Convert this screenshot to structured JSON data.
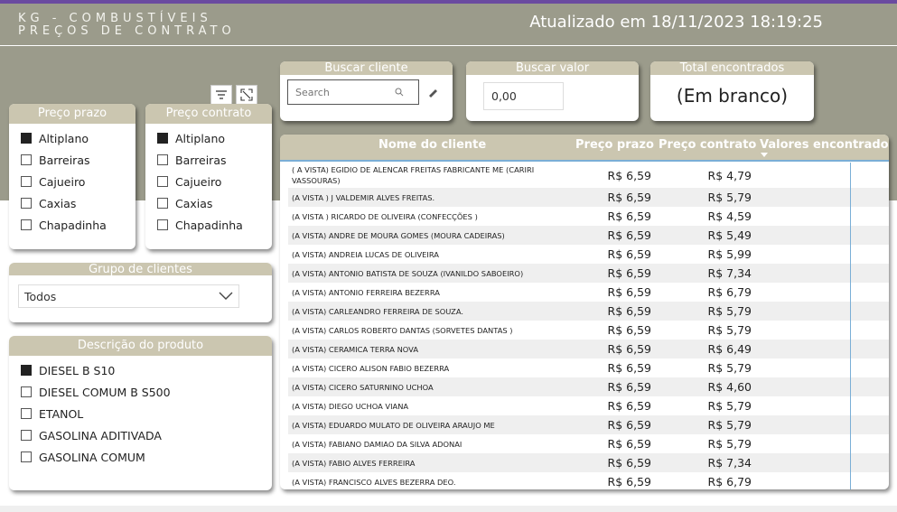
{
  "header": {
    "title_line1": "KG - COMBUSTÍVEIS",
    "title_line2": "PREÇOS DE CONTRATO",
    "updated": "Atualizado em 18/11/2023 18:19:25"
  },
  "preco_prazo": {
    "title": "Preço prazo",
    "items": [
      {
        "label": "Altiplano",
        "checked": true
      },
      {
        "label": "Barreiras",
        "checked": false
      },
      {
        "label": "Cajueiro",
        "checked": false
      },
      {
        "label": "Caxias",
        "checked": false
      },
      {
        "label": "Chapadinha",
        "checked": false
      }
    ]
  },
  "preco_contrato": {
    "title": "Preço contrato",
    "items": [
      {
        "label": "Altiplano",
        "checked": true
      },
      {
        "label": "Barreiras",
        "checked": false
      },
      {
        "label": "Cajueiro",
        "checked": false
      },
      {
        "label": "Caxias",
        "checked": false
      },
      {
        "label": "Chapadinha",
        "checked": false
      }
    ]
  },
  "grupo": {
    "title": "Grupo de clientes",
    "selected": "Todos"
  },
  "produto": {
    "title": "Descrição do produto",
    "items": [
      {
        "label": "DIESEL B S10",
        "checked": true
      },
      {
        "label": "DIESEL COMUM B S500",
        "checked": false
      },
      {
        "label": "ETANOL",
        "checked": false
      },
      {
        "label": "GASOLINA ADITIVADA",
        "checked": false
      },
      {
        "label": "GASOLINA COMUM",
        "checked": false
      }
    ]
  },
  "buscar_cliente": {
    "title": "Buscar cliente",
    "placeholder": "Search"
  },
  "buscar_valor": {
    "title": "Buscar valor",
    "value": "0,00"
  },
  "total": {
    "title": "Total encontrados",
    "value": "(Em branco)"
  },
  "table": {
    "columns": [
      "Nome do cliente",
      "Preço prazo",
      "Preço contrato",
      "Valores encontrados"
    ],
    "rows": [
      {
        "nome": "( A VISTA) EGIDIO DE ALENCAR FREITAS FABRICANTE ME (CARIRI VASSOURAS)",
        "prazo": "R$ 6,59",
        "contrato": "R$ 4,79"
      },
      {
        "nome": "(A VISTA ) J VALDEMIR ALVES FREITAS.",
        "prazo": "R$ 6,59",
        "contrato": "R$ 5,79"
      },
      {
        "nome": "(A VISTA ) RICARDO DE OLIVEIRA (CONFECÇÕES )",
        "prazo": "R$ 6,59",
        "contrato": "R$ 4,59"
      },
      {
        "nome": "(A VISTA) ANDRE DE MOURA GOMES (MOURA CADEIRAS)",
        "prazo": "R$ 6,59",
        "contrato": "R$ 5,49"
      },
      {
        "nome": "(A VISTA) ANDREIA LUCAS DE OLIVEIRA",
        "prazo": "R$ 6,59",
        "contrato": "R$ 5,99"
      },
      {
        "nome": "(A VISTA) ANTONIO BATISTA DE SOUZA (IVANILDO SABOEIRO)",
        "prazo": "R$ 6,59",
        "contrato": "R$ 7,34"
      },
      {
        "nome": "(A VISTA) ANTONIO FERREIRA BEZERRA",
        "prazo": "R$ 6,59",
        "contrato": "R$ 6,79"
      },
      {
        "nome": "(A VISTA) CARLEANDRO FERREIRA DE SOUZA.",
        "prazo": "R$ 6,59",
        "contrato": "R$ 5,79"
      },
      {
        "nome": "(A VISTA) CARLOS ROBERTO DANTAS (SORVETES DANTAS )",
        "prazo": "R$ 6,59",
        "contrato": "R$ 5,79"
      },
      {
        "nome": "(A VISTA) CERAMICA TERRA NOVA",
        "prazo": "R$ 6,59",
        "contrato": "R$ 6,49"
      },
      {
        "nome": "(A VISTA) CICERO ALISON FABIO BEZERRA",
        "prazo": "R$ 6,59",
        "contrato": "R$ 5,79"
      },
      {
        "nome": "(A VISTA) CICERO SATURNINO UCHOA",
        "prazo": "R$ 6,59",
        "contrato": "R$ 4,60"
      },
      {
        "nome": "(A VISTA) DIEGO UCHOA VIANA",
        "prazo": "R$ 6,59",
        "contrato": "R$ 5,79"
      },
      {
        "nome": "(A VISTA) EDUARDO MULATO DE OLIVEIRA ARAUJO ME",
        "prazo": "R$ 6,59",
        "contrato": "R$ 5,79"
      },
      {
        "nome": "(A VISTA) FABIANO DAMIAO DA SILVA ADONAI",
        "prazo": "R$ 6,59",
        "contrato": "R$ 5,79"
      },
      {
        "nome": "(A VISTA) FABIO ALVES FERREIRA",
        "prazo": "R$ 6,59",
        "contrato": "R$ 7,34"
      },
      {
        "nome": "(A VISTA) FRANCISCO ALVES BEZERRA DEO.",
        "prazo": "R$ 6,59",
        "contrato": "R$ 6,79"
      }
    ]
  },
  "colors": {
    "header_bg": "#9b9b8b",
    "card_head": "#cbc6b0",
    "accent_bar": "#6a4aa0",
    "table_line": "#7aaed6"
  },
  "icons": {
    "filter": "filter-icon",
    "focus": "focus-mode-icon",
    "search": "search-icon",
    "eraser": "eraser-icon",
    "dropdown": "chevron-down-icon",
    "sort": "sort-desc-icon"
  }
}
